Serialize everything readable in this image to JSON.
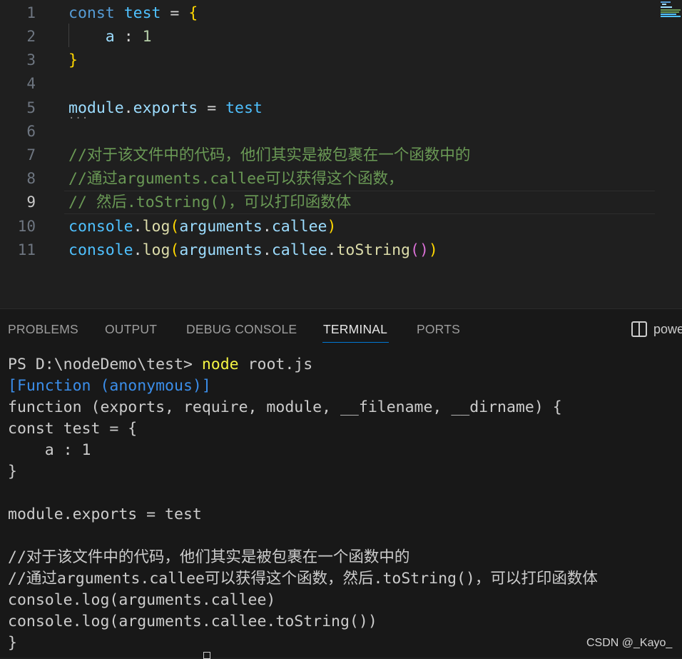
{
  "editor": {
    "line_numbers": [
      "1",
      "2",
      "3",
      "4",
      "5",
      "6",
      "7",
      "8",
      "9",
      "10",
      "11"
    ],
    "active_line": "9",
    "lines": {
      "l1": {
        "kw": "const",
        "var": "test",
        "op": "=",
        "br": "{"
      },
      "l2": {
        "prop": "a",
        "op": ":",
        "num": "1"
      },
      "l3": {
        "br": "}"
      },
      "l5": {
        "a": "module",
        "dot": ".",
        "b": "exports",
        "op": "=",
        "c": "test"
      },
      "l7": "//对于该文件中的代码，他们其实是被包裹在一个函数中的",
      "l8": "//通过arguments.callee可以获得这个函数，",
      "l9": "// 然后.toString()，可以打印函数体",
      "l10": {
        "obj": "console",
        "dot": ".",
        "fn": "log",
        "po": "(",
        "arg": "arguments",
        "dot2": ".",
        "prop": "callee",
        "pc": ")"
      },
      "l11": {
        "obj": "console",
        "dot": ".",
        "fn": "log",
        "po": "(",
        "arg": "arguments",
        "dot2": ".",
        "prop": "callee",
        "dot3": ".",
        "fn2": "toString",
        "po2": "(",
        "pc2": ")",
        "pc": ")"
      }
    }
  },
  "panel": {
    "tabs": [
      "PROBLEMS",
      "OUTPUT",
      "DEBUG CONSOLE",
      "TERMINAL",
      "PORTS"
    ],
    "active_tab": "TERMINAL",
    "terminal_name": "powe",
    "terminal": {
      "prompt": "PS D:\\nodeDemo\\test> ",
      "cmd": "node",
      "args": " root.js",
      "lines": [
        "[Function (anonymous)]",
        "function (exports, require, module, __filename, __dirname) {",
        "const test = {",
        "    a : 1",
        "}",
        "",
        "module.exports = test",
        "",
        "//对于该文件中的代码，他们其实是被包裹在一个函数中的",
        "//通过arguments.callee可以获得这个函数，然后.toString()，可以打印函数体",
        "console.log(arguments.callee)",
        "console.log(arguments.callee.toString())",
        "}"
      ]
    }
  },
  "watermark": "CSDN @_Kayo_",
  "colors": {
    "keyword": "#569cd6",
    "variable": "#4fc1ff",
    "property": "#9cdcfe",
    "function": "#dcdcaa",
    "comment": "#6a9955",
    "bracket1": "#ffd700",
    "bracket2": "#da70d6",
    "terminal_yellow": "#f5f543",
    "terminal_blue": "#3b8eea",
    "accent": "#0078d4"
  }
}
